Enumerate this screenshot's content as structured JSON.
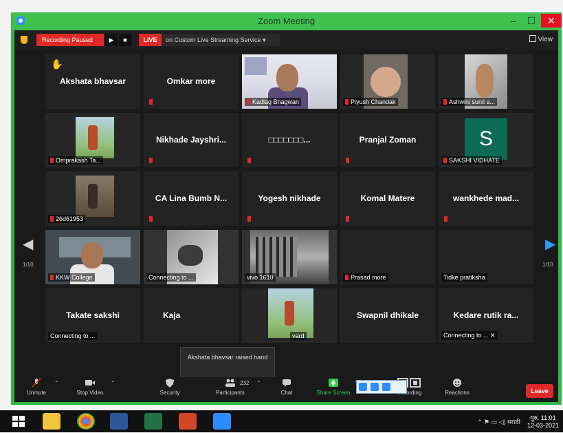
{
  "window": {
    "title": "Zoom Meeting",
    "minimize": "–",
    "maximize": "☐",
    "close": "✕"
  },
  "topbar": {
    "recording": "Recording Paused",
    "play": "▶",
    "stop": "■",
    "live": "LIVE",
    "live_service": "on Custom Live Streaming Service ▾",
    "view": "View"
  },
  "tiles": [
    {
      "name": "Akshata bhavsar",
      "label": ""
    },
    {
      "name": "Omkar more",
      "label": ""
    },
    {
      "name": "",
      "label": "Kadlag Bhagwan"
    },
    {
      "name": "",
      "label": "Piyush Chandak"
    },
    {
      "name": "",
      "label": "Ashwini sunil a..."
    },
    {
      "name": "",
      "label": "Omprakash Ta..."
    },
    {
      "name": "Nikhade Jayshri...",
      "label": ""
    },
    {
      "name": "□□□□□□□...",
      "label": ""
    },
    {
      "name": "Pranjal Zoman",
      "label": ""
    },
    {
      "name": "S",
      "label": "SAKSHI VIDHATE"
    },
    {
      "name": "",
      "label": "26d61953"
    },
    {
      "name": "CA Lina Bumb N...",
      "label": ""
    },
    {
      "name": "Yogesh nikhade",
      "label": ""
    },
    {
      "name": "Komal Matere",
      "label": ""
    },
    {
      "name": "wankhede mad...",
      "label": ""
    },
    {
      "name": "",
      "label": "KKW College"
    },
    {
      "name": "",
      "label": "Connecting to ..."
    },
    {
      "name": "",
      "label": "vivo 1610"
    },
    {
      "name": "",
      "label": "Prasad more"
    },
    {
      "name": "",
      "label": "Tidke pratiksha"
    },
    {
      "name": "Takate sakshi",
      "label": "Connecting to ..."
    },
    {
      "name": "Kaja",
      "label": ""
    },
    {
      "name": "",
      "label": "vard"
    },
    {
      "name": "Swapnil dhikale",
      "label": ""
    },
    {
      "name": "Kedare rutik ra...",
      "label": "Connecting to ... ✕"
    }
  ],
  "nav": {
    "left_count": "1/10",
    "right_count": "1/10"
  },
  "tooltip": "Akshata bhavsar raised hand",
  "toolbar": {
    "unmute": "Unmute",
    "stop_video": "Stop Video",
    "security": "Security",
    "participants": "Participants",
    "participants_count": "232",
    "chat": "Chat",
    "share_screen": "Share Screen",
    "recording": "Recording",
    "reactions": "Reactions",
    "leave": "Leave"
  },
  "taskbar": {
    "tray_lang": "मराठी",
    "time": "11:01",
    "date": "12-03-2021",
    "tray_day": "गुरु."
  },
  "colors": {
    "accent_green": "#2db843",
    "recording_red": "#e02828",
    "zoom_blue": "#2d8cff"
  }
}
